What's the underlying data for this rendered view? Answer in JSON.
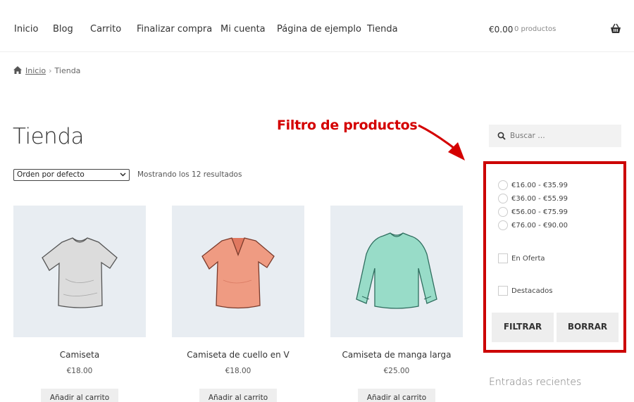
{
  "nav": {
    "items": [
      "Inicio",
      "Blog",
      "Carrito",
      "Finalizar compra",
      "Mi cuenta",
      "Página de ejemplo",
      "Tienda"
    ],
    "cart_total": "€0.00",
    "cart_count": "0 productos",
    "cart_icon": "basket-icon"
  },
  "breadcrumb": {
    "home": "Inicio",
    "separator": "›",
    "current": "Tienda"
  },
  "page": {
    "title": "Tienda"
  },
  "toolbar": {
    "orderby": "Orden por defecto",
    "result_count": "Mostrando los 12 resultados"
  },
  "products": [
    {
      "name": "Camiseta",
      "price": "€18.00",
      "button": "Añadir al carrito"
    },
    {
      "name": "Camiseta de cuello en V",
      "price": "€18.00",
      "button": "Añadir al carrito"
    },
    {
      "name": "Camiseta de manga larga",
      "price": "€25.00",
      "button": "Añadir al carrito"
    }
  ],
  "annotation": {
    "title": "Filtro de productos",
    "color": "#d40000"
  },
  "sidebar": {
    "search_placeholder": "Buscar …",
    "price_ranges": [
      "€16.00 - €35.99",
      "€36.00 - €55.99",
      "€56.00 - €75.99",
      "€76.00 - €90.00"
    ],
    "on_sale": "En Oferta",
    "featured": "Destacados",
    "filter_button": "FILTRAR",
    "clear_button": "BORRAR",
    "recent_posts_heading": "Entradas recientes"
  }
}
